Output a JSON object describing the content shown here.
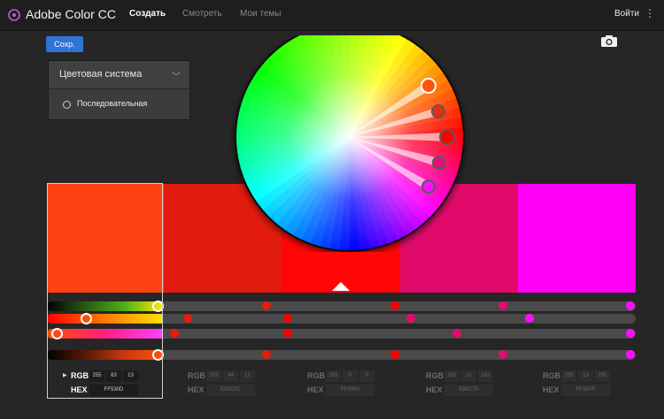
{
  "header": {
    "app_title": "Adobe Color CC",
    "nav": [
      {
        "label": "Создать",
        "active": true
      },
      {
        "label": "Смотреть",
        "active": false
      },
      {
        "label": "Мои темы",
        "active": false
      }
    ],
    "login_label": "Войти"
  },
  "toolbar": {
    "save_label": "Сохр."
  },
  "color_system": {
    "title": "Цветовая система",
    "option": "Последовательная"
  },
  "swatches": [
    {
      "hex": "#FF530D",
      "rgb": [
        "255",
        "83",
        "13"
      ],
      "hex_text": "FF530D"
    },
    {
      "hex": "#E82C0C",
      "rgb": [
        "232",
        "44",
        "12"
      ],
      "hex_text": "E82C0C"
    },
    {
      "hex": "#FF0000",
      "rgb": [
        "255",
        "0",
        "0"
      ],
      "hex_text": "FF0000"
    },
    {
      "hex": "#E80C7A",
      "rgb": [
        "232",
        "12",
        "122"
      ],
      "hex_text": "E80C7A"
    },
    {
      "hex": "#FF0DFF",
      "rgb": [
        "255",
        "13",
        "255"
      ],
      "hex_text": "FF0DFF"
    }
  ],
  "labels": {
    "rgb": "RGB",
    "hex": "HEX"
  }
}
